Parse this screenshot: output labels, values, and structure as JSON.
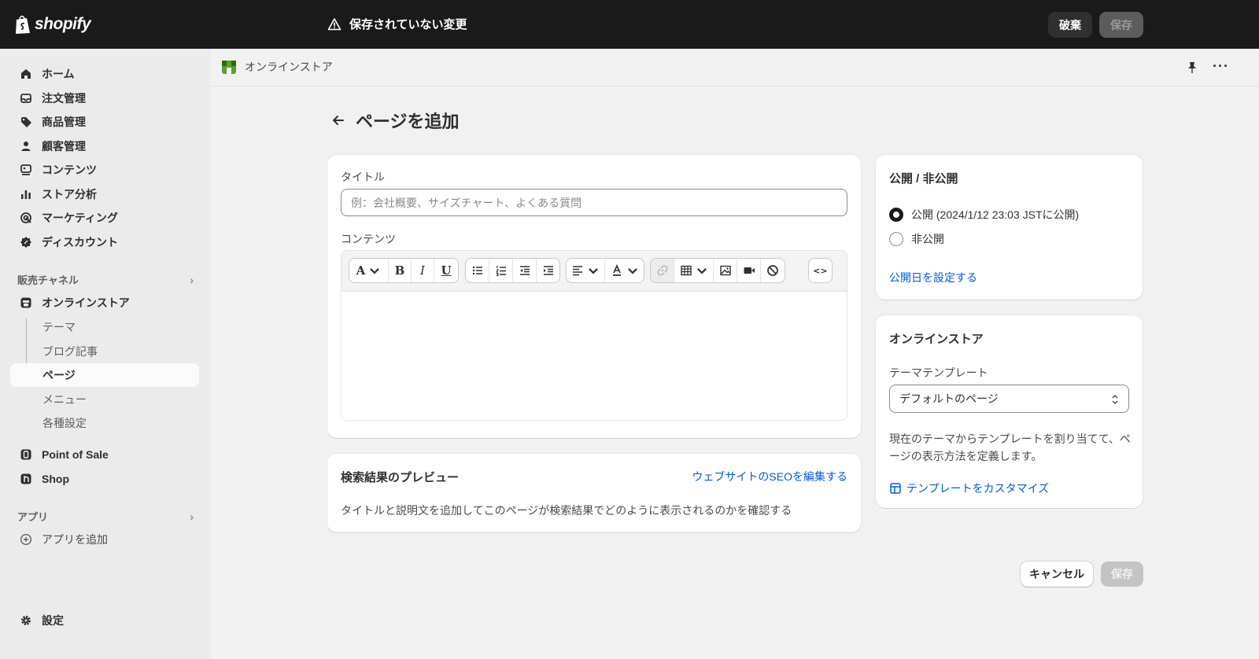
{
  "topbar": {
    "logo_text": "shopify",
    "unsaved_text": "保存されていない変更",
    "discard_label": "破棄",
    "save_label": "保存"
  },
  "sidebar": {
    "main_items": [
      {
        "label": "ホーム",
        "icon": "home-icon"
      },
      {
        "label": "注文管理",
        "icon": "inbox-icon"
      },
      {
        "label": "商品管理",
        "icon": "tag-icon"
      },
      {
        "label": "顧客管理",
        "icon": "person-icon"
      },
      {
        "label": "コンテンツ",
        "icon": "content-icon"
      },
      {
        "label": "ストア分析",
        "icon": "bar-chart-icon"
      },
      {
        "label": "マーケティング",
        "icon": "target-icon"
      },
      {
        "label": "ディスカウント",
        "icon": "discount-icon"
      }
    ],
    "sales_channels_title": "販売チャネル",
    "online_store_label": "オンラインストア",
    "online_store_subitems": [
      "テーマ",
      "ブログ記事",
      "ページ",
      "メニュー",
      "各種設定"
    ],
    "point_of_sale_label": "Point of Sale",
    "shop_label": "Shop",
    "apps_title": "アプリ",
    "add_app_label": "アプリを追加",
    "settings_label": "設定"
  },
  "header": {
    "breadcrumb": "オンラインストア",
    "page_title": "ページを追加"
  },
  "content_card": {
    "title_label": "タイトル",
    "title_placeholder": "例：会社概要、サイズチャート、よくある質問",
    "title_value": "",
    "content_label": "コンテンツ",
    "html_button_label": "<>"
  },
  "seo_card": {
    "title": "検索結果のプレビュー",
    "edit_link": "ウェブサイトのSEOを編集する",
    "description": "タイトルと説明文を追加してこのページが検索結果でどのように表示されるのかを確認する"
  },
  "visibility_card": {
    "title": "公開 / 非公開",
    "option_public": "公開 (2024/1/12 23:03 JSTに公開)",
    "option_hidden": "非公開",
    "selected": "public",
    "set_date_link": "公開日を設定する"
  },
  "online_store_card": {
    "title": "オンラインストア",
    "template_label": "テーマテンプレート",
    "template_value": "デフォルトのページ",
    "helper_text": "現在のテーマからテンプレートを割り当てて、ページの表示方法を定義します。",
    "customize_link": "テンプレートをカスタマイズ"
  },
  "footer": {
    "cancel_label": "キャンセル",
    "save_label": "保存"
  }
}
